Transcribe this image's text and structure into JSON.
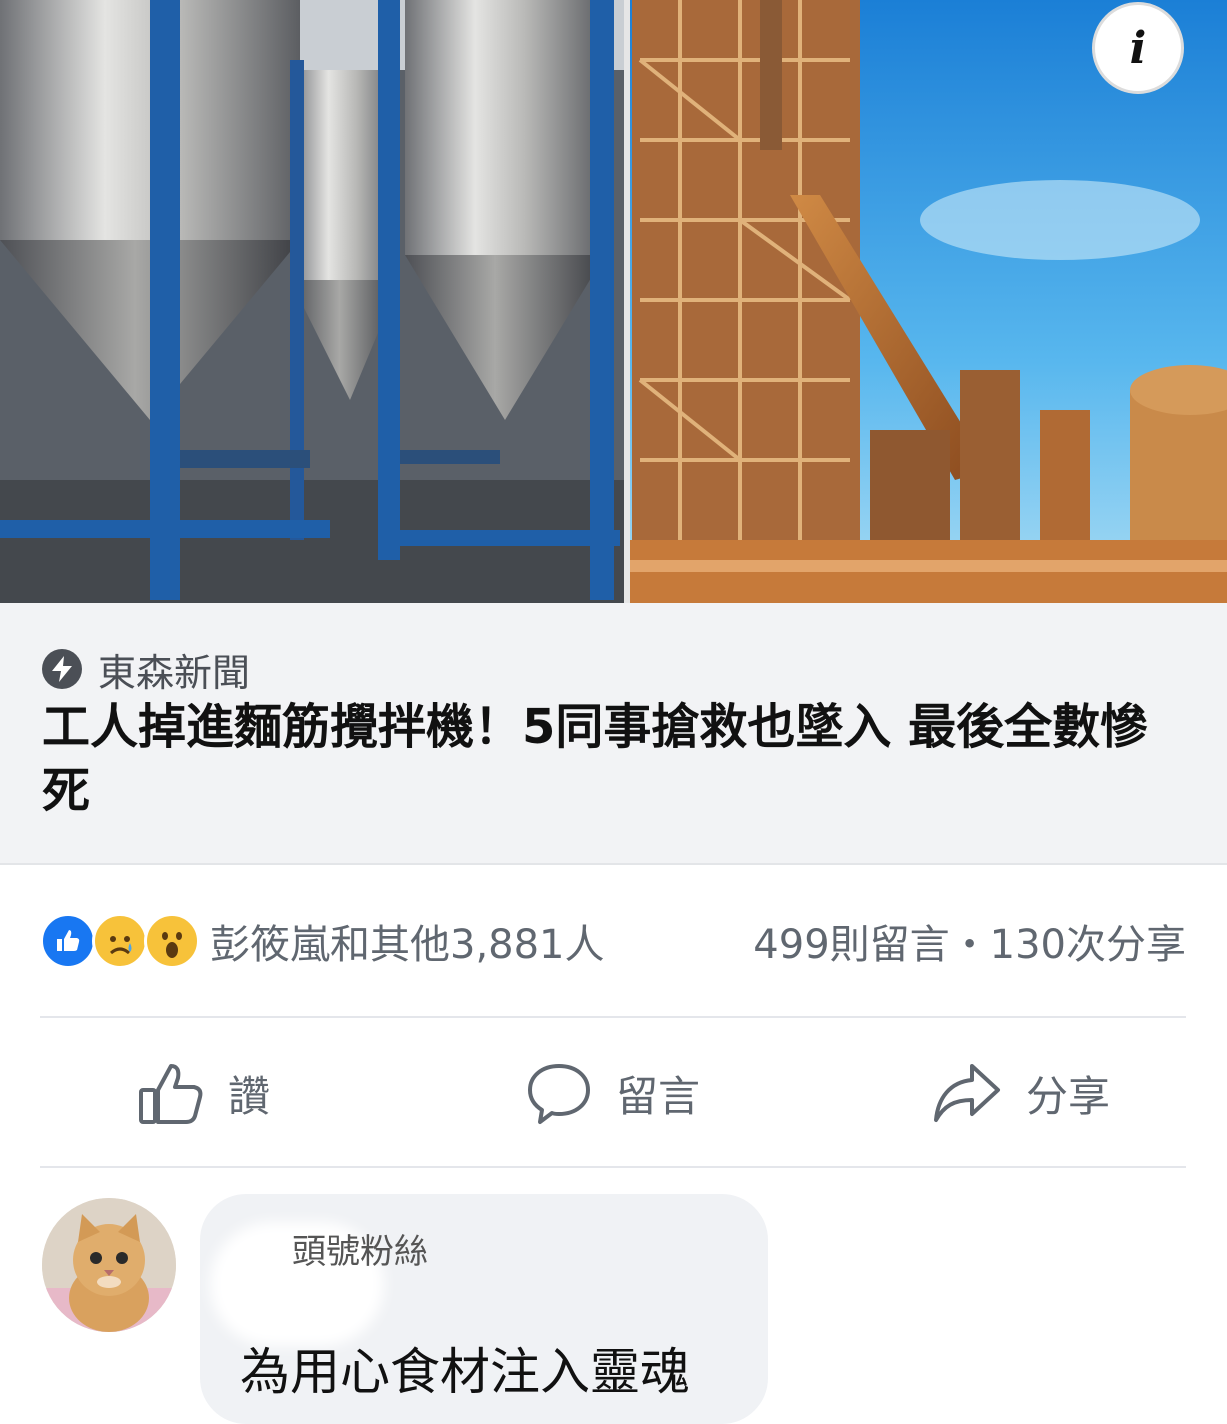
{
  "post": {
    "info_symbol": "i",
    "link": {
      "source": "東森新聞",
      "headline": "工人掉進麵筋攪拌機！5同事搶救也墜入 最後全數慘死"
    },
    "reactions": {
      "icons": [
        "like-icon",
        "sad-icon",
        "wow-icon"
      ],
      "reactors_text": "彭筱嵐和其他3,881人",
      "counts_text": "499則留言・130次分享"
    },
    "actions": {
      "like": "讚",
      "comment": "留言",
      "share": "分享"
    },
    "comment": {
      "badge": "頭號粉絲",
      "text": "為用心食材注入靈魂"
    }
  },
  "colors": {
    "card_bg": "#f2f3f5",
    "meta_gray": "#606770",
    "like_blue": "#1877f2",
    "reaction_yellow": "#f7c23a"
  }
}
